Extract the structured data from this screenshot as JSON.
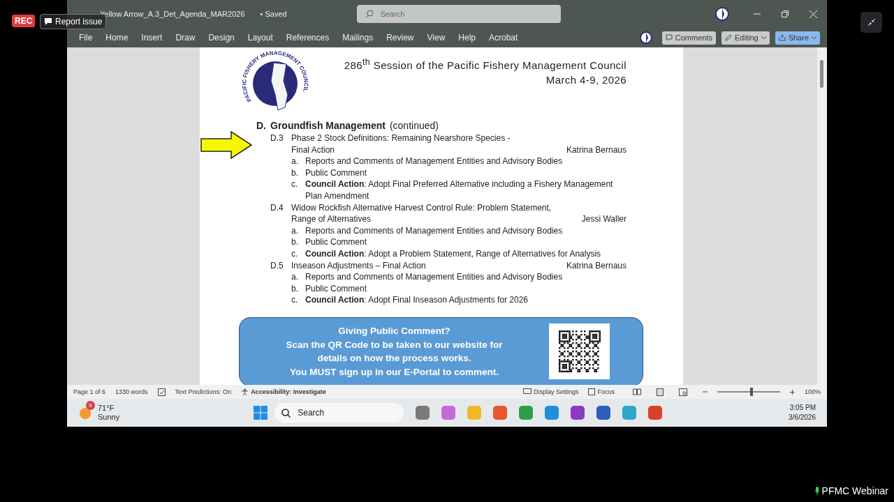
{
  "overlay": {
    "rec": "REC",
    "report_issue": "Report issue",
    "webinar": "PFMC Webinar"
  },
  "title_bar": {
    "filename": "Yellow Arrow_A.3_Det_Agenda_MAR2026",
    "save_state": "• Saved",
    "search_placeholder": "Search"
  },
  "ribbon_tabs": [
    "File",
    "Home",
    "Insert",
    "Draw",
    "Design",
    "Layout",
    "References",
    "Mailings",
    "Review",
    "View",
    "Help",
    "Acrobat"
  ],
  "ribbon_buttons": {
    "comments": "Comments",
    "editing": "Editing",
    "share": "Share"
  },
  "document": {
    "logo_text": "PACIFIC FISHERY MANAGEMENT COUNCIL",
    "heading": [
      "286$^{th}$ Session of the Pacific Fishery Management Council",
      "March 4-9, 2026"
    ],
    "section": {
      "letter": "D.",
      "title": "Groundfish Management",
      "suffix": "(continued)"
    },
    "items": [
      {
        "number": "D.3",
        "title": [
          "Phase 2 Stock Definitions: Remaining Nearshore Species -",
          "Final Action"
        ],
        "presenter": "Katrina Bernaus",
        "arrow": true,
        "subitems": [
          {
            "letter": "a.",
            "text": "Reports and Comments of Management Entities and Advisory Bodies"
          },
          {
            "letter": "b.",
            "text": "Public Comment"
          },
          {
            "letter": "c.",
            "text": "**Council Action**: Adopt Final Preferred Alternative including a Fishery Management Plan Amendment"
          }
        ]
      },
      {
        "number": "D.4",
        "title": [
          "Widow Rockfish Alternative Harvest Control Rule: Problem Statement,",
          "Range of Alternatives"
        ],
        "presenter": "Jessi Waller",
        "arrow": false,
        "subitems": [
          {
            "letter": "a.",
            "text": "Reports and Comments of Management Entities and Advisory Bodies"
          },
          {
            "letter": "b.",
            "text": "Public Comment"
          },
          {
            "letter": "c.",
            "text": "**Council Action**: Adopt a Problem Statement, Range of Alternatives for Analysis"
          }
        ]
      },
      {
        "number": "D.5",
        "title": [
          "Inseason Adjustments – Final Action"
        ],
        "presenter": "Katrina Bernaus",
        "arrow": false,
        "subitems": [
          {
            "letter": "a.",
            "text": "Reports and Comments of Management Entities and Advisory Bodies"
          },
          {
            "letter": "b.",
            "text": "Public Comment"
          },
          {
            "letter": "c.",
            "text": "**Council Action**:  Adopt Final Inseason Adjustments for 2026"
          }
        ]
      }
    ],
    "callout": [
      "Giving Public Comment?",
      "Scan the QR Code to be taken to our website for",
      "details on how the process works.",
      "You MUST sign up in our E-Portal to comment."
    ]
  },
  "status_bar": {
    "page": "Page 1 of 6",
    "words": "1330 words",
    "text_predictions": "Text Predictions: On",
    "accessibility": "Accessibility: Investigate",
    "display_settings": "Display Settings",
    "focus": "Focus",
    "zoom": {
      "level": 0.55
    },
    "zoom_text": "100%"
  },
  "taskbar": {
    "temperature": "71°F",
    "weather": "Sunny",
    "badge": "5",
    "search": "Search",
    "apps": [
      {
        "color": "#7a7a7a"
      },
      {
        "color": "#c56ad8"
      },
      {
        "color": "#f2b824"
      },
      {
        "color": "#e8562a"
      },
      {
        "color": "#2e9e48"
      },
      {
        "color": "#1f8fd8"
      },
      {
        "color": "#8a3cc4"
      },
      {
        "color": "#2b5fb8"
      },
      {
        "color": "#2aa7c9"
      },
      {
        "color": "#d9402c"
      }
    ],
    "time": "3:05 PM",
    "date": "3/6/2026"
  }
}
